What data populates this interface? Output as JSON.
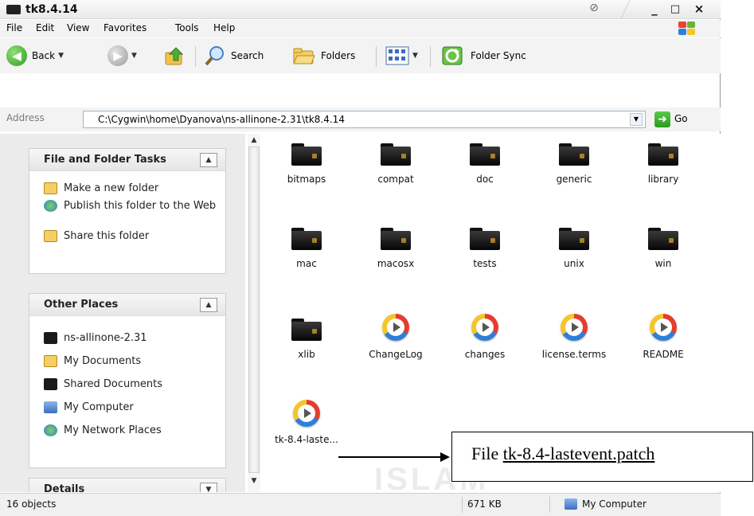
{
  "window": {
    "title": "tk8.4.14",
    "controls": {
      "minimize": "_",
      "maximize": "□",
      "close": "×"
    }
  },
  "menu": [
    "File",
    "Edit",
    "View",
    "Favorites",
    "Tools",
    "Help"
  ],
  "toolbar": {
    "back_label": "Back",
    "search_label": "Search",
    "folders_label": "Folders",
    "sync_label": "Folder Sync"
  },
  "address": {
    "label": "Address",
    "path": "C:\\Cygwin\\home\\Dyanova\\ns-allinone-2.31\\tk8.4.14",
    "go_label": "Go"
  },
  "left_panel": {
    "file_folder_tasks": {
      "title": "File and Folder Tasks",
      "items": [
        "Make a new folder",
        "Publish this folder to the Web",
        "Share this folder"
      ]
    },
    "other_places": {
      "title": "Other Places",
      "items": [
        "ns-allinone-2.31",
        "My Documents",
        "Shared Documents",
        "My Computer",
        "My Network Places"
      ]
    },
    "details": {
      "title": "Details"
    }
  },
  "files": [
    {
      "name": "bitmaps",
      "type": "folder"
    },
    {
      "name": "compat",
      "type": "folder"
    },
    {
      "name": "doc",
      "type": "folder"
    },
    {
      "name": "generic",
      "type": "folder"
    },
    {
      "name": "library",
      "type": "folder"
    },
    {
      "name": "mac",
      "type": "folder"
    },
    {
      "name": "macosx",
      "type": "folder"
    },
    {
      "name": "tests",
      "type": "folder"
    },
    {
      "name": "unix",
      "type": "folder"
    },
    {
      "name": "win",
      "type": "folder"
    },
    {
      "name": "xlib",
      "type": "folder"
    },
    {
      "name": "ChangeLog",
      "type": "media"
    },
    {
      "name": "changes",
      "type": "media"
    },
    {
      "name": "license.terms",
      "type": "media"
    },
    {
      "name": "README",
      "type": "media"
    },
    {
      "name": "tk-8.4-laste...",
      "type": "media"
    }
  ],
  "status": {
    "objects": "16 objects",
    "size": "671 KB",
    "location": "My Computer"
  },
  "annotation": {
    "prefix": "File ",
    "filename": "tk-8.4-lastevent.patch"
  },
  "watermark": "ISLAM",
  "colors": {
    "panel_bg": "#ebebeb",
    "toolbar_bg": "#f3f3f3",
    "go_green": "#2c9a20"
  }
}
